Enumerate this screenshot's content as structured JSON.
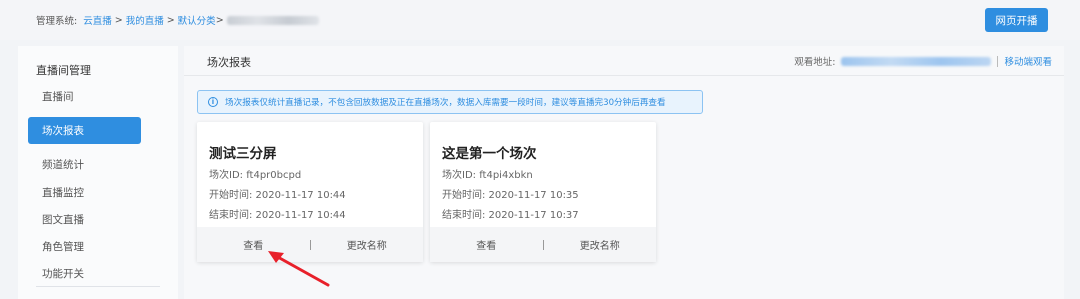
{
  "breadcrumb": {
    "prefix": "管理系统:",
    "items": [
      "云直播",
      "我的直播",
      "默认分类"
    ],
    "separator": ">",
    "trailing_sep": ">"
  },
  "header": {
    "web_start_label": "网页开播"
  },
  "sidebar": {
    "group_title": "直播间管理",
    "items": [
      {
        "label": "直播间"
      },
      {
        "label": "场次报表",
        "active": true
      },
      {
        "label": "频道统计"
      },
      {
        "label": "直播监控"
      },
      {
        "label": "图文直播"
      },
      {
        "label": "角色管理"
      },
      {
        "label": "功能开关"
      }
    ]
  },
  "main": {
    "title": "场次报表",
    "watch_label": "观看地址:",
    "mobile_watch_label": "移动端观看",
    "notice": "场次报表仅统计直播记录，不包含回放数据及正在直播场次，数据入库需要一段时间，建议等直播完30分钟后再查看"
  },
  "cards": [
    {
      "title": "测试三分屏",
      "session_id": "场次ID: ft4pr0bcpd",
      "start": "开始时间: 2020-11-17 10:44",
      "end": "结束时间: 2020-11-17 10:44",
      "view_label": "查看",
      "rename_label": "更改名称"
    },
    {
      "title": "这是第一个场次",
      "session_id": "场次ID: ft4pi4xbkn",
      "start": "开始时间: 2020-11-17 10:35",
      "end": "结束时间: 2020-11-17 10:37",
      "view_label": "查看",
      "rename_label": "更改名称"
    }
  ],
  "colors": {
    "accent": "#2f8ee0",
    "annotation_arrow": "#e8202a"
  },
  "icons": {
    "notice_icon": "info-circle-icon",
    "annotation": "red-arrow-icon"
  }
}
